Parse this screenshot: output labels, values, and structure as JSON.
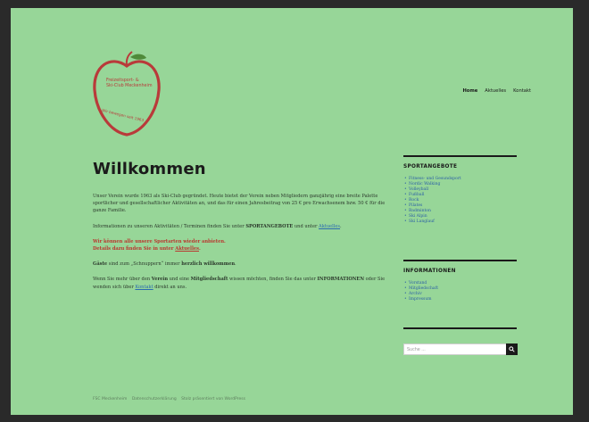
{
  "site": {
    "logo_lines": [
      "Freizeitsport- &",
      "Ski-Club Meckenheim"
    ],
    "logo_tagline": "Wir bewegen seit 1963",
    "nav": [
      {
        "label": "Home",
        "active": true
      },
      {
        "label": "Aktuelles",
        "active": false
      },
      {
        "label": "Kontakt",
        "active": false
      }
    ]
  },
  "page": {
    "title": "Willkommen",
    "paragraphs": {
      "p1": "Unser Verein wurde 1963 als Ski-Club gegründet. Heute bietet der Verein neben Mitgliedern ganzjährig eine breite Palette sportlicher und gesellschaftlicher Aktivitäten an, und das für einen Jahresbeitrag von 25 € pro Erwachsenem bzw. 50 € für die ganze Familie.",
      "p2_pre": "Informationen zu unseren Aktivitäten / Terminen finden Sie unter ",
      "p2_strong": "SPORTANGEBOTE",
      "p2_mid": " und unter ",
      "p2_link": "Aktuelles",
      "p2_end": ".",
      "p3_line1": "Wir können alle unsere Sportarten wieder anbieten.",
      "p3_line2_pre": "Details dazu finden Sie in unter ",
      "p3_link": "Aktuelles",
      "p3_end": ".",
      "p4_strong1": "Gäste",
      "p4_mid": " sind zum „Schnuppern“ immer ",
      "p4_strong2": "herzlich willkommen",
      "p4_end": ".",
      "p5_pre": "Wenn Sie mehr über den ",
      "p5_strong1": "Verein",
      "p5_mid1": " und eine ",
      "p5_strong2": "Mitgliedschaft",
      "p5_mid2": " wissen möchten, finden Sie das unter ",
      "p5_strong3": "INFORMATIONEN",
      "p5_mid3": " oder Sie wenden sich über ",
      "p5_link": "Kontakt",
      "p5_end": " direkt an uns."
    }
  },
  "sidebar": {
    "sportangebote": {
      "title": "SPORTANGEBOTE",
      "items": [
        "Fitness- und Gesundsport",
        "Nordic Walking",
        "Volleyball",
        "Fußball",
        "Rock",
        "Pilates",
        "Badminton",
        "Ski Alpin",
        "Ski Langlauf"
      ]
    },
    "informationen": {
      "title": "INFORMATIONEN",
      "items": [
        "Vorstand",
        "Mitgliedschaft",
        "Archiv",
        "Impressum"
      ]
    },
    "search": {
      "placeholder": "Suche ..."
    }
  },
  "footer": {
    "items": [
      "FSC Meckenheim",
      "Datenschutzerklärung",
      "Stolz präsentiert von WordPress"
    ]
  },
  "colors": {
    "background": "#97d698",
    "brand_red": "#b93a3a",
    "link_blue": "#2b6cb0"
  }
}
